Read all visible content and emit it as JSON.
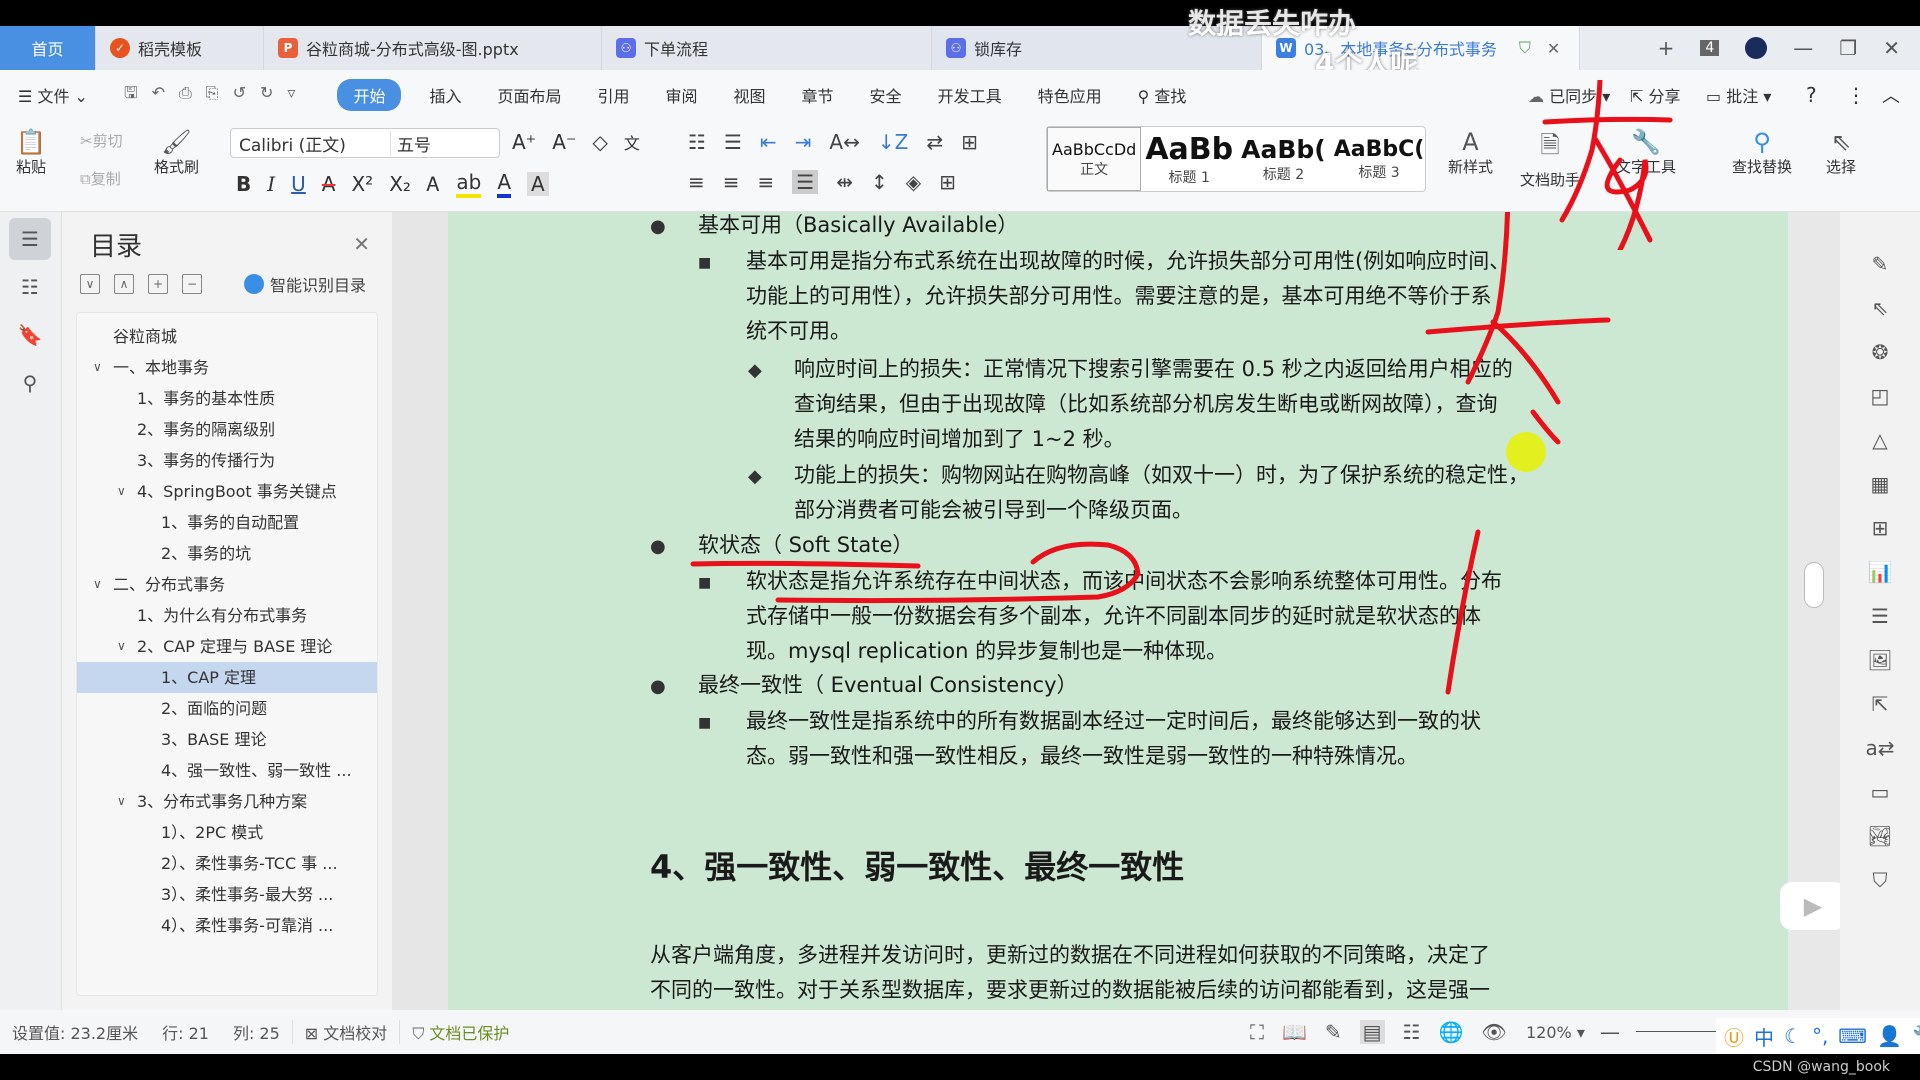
{
  "overlay_captions": [
    "数据丢失咋办",
    "4个人呢"
  ],
  "tabs": [
    {
      "label": "首页"
    },
    {
      "label": "稻壳模板",
      "icon": "docer-icon",
      "color": "#e8521f"
    },
    {
      "label": "谷粒商城-分布式高级-图.pptx",
      "icon": "pptx-icon",
      "color": "#e8613a"
    },
    {
      "label": "下单流程",
      "icon": "flowchart-icon",
      "color": "#5b6fe8"
    },
    {
      "label": "锁库存",
      "icon": "flowchart-icon",
      "color": "#5b6fe8"
    },
    {
      "label": "03、本地事务&分布式事务",
      "icon": "word-icon",
      "color": "#3d7fe0",
      "active": true
    }
  ],
  "window": {
    "tab_count": "4"
  },
  "menu": {
    "file": "文件",
    "items": [
      "开始",
      "插入",
      "页面布局",
      "引用",
      "审阅",
      "视图",
      "章节",
      "安全",
      "开发工具",
      "特色应用"
    ],
    "search": "查找",
    "synced": "已同步",
    "share": "分享",
    "comment": "批注"
  },
  "ribbon": {
    "paste": "粘贴",
    "cut": "剪切",
    "copy": "复制",
    "format_painter": "格式刷",
    "font_name": "Calibri (正文)",
    "font_size": "五号",
    "styles": [
      {
        "preview": "AaBbCcDd",
        "label": "正文"
      },
      {
        "preview": "AaBb",
        "label": "标题 1"
      },
      {
        "preview": "AaBb(",
        "label": "标题 2"
      },
      {
        "preview": "AaBbC(",
        "label": "标题 3"
      }
    ],
    "new_style": "新样式",
    "doc_assistant": "文档助手",
    "text_tools": "文字工具",
    "find_replace": "查找替换",
    "select": "选择"
  },
  "toc": {
    "title": "目录",
    "smart": "智能识别目录",
    "items": [
      {
        "label": "谷粒商城",
        "level": 0
      },
      {
        "label": "一、本地事务",
        "level": 0,
        "expanded": true
      },
      {
        "label": "1、事务的基本性质",
        "level": 1
      },
      {
        "label": "2、事务的隔离级别",
        "level": 1
      },
      {
        "label": "3、事务的传播行为",
        "level": 1
      },
      {
        "label": "4、SpringBoot 事务关键点",
        "level": 1,
        "expanded": true
      },
      {
        "label": "1、事务的自动配置",
        "level": 2
      },
      {
        "label": "2、事务的坑",
        "level": 2
      },
      {
        "label": "二、分布式事务",
        "level": 0,
        "expanded": true
      },
      {
        "label": "1、为什么有分布式事务",
        "level": 1
      },
      {
        "label": "2、CAP 定理与 BASE 理论",
        "level": 1,
        "expanded": true
      },
      {
        "label": "1、CAP 定理",
        "level": 2,
        "selected": true
      },
      {
        "label": "2、面临的问题",
        "level": 2
      },
      {
        "label": "3、BASE 理论",
        "level": 2
      },
      {
        "label": "4、强一致性、弱一致性 ...",
        "level": 2
      },
      {
        "label": "3、分布式事务几种方案",
        "level": 1,
        "expanded": true
      },
      {
        "label": "1）、2PC 模式",
        "level": 2
      },
      {
        "label": "2）、柔性事务-TCC 事 ...",
        "level": 2
      },
      {
        "label": "3）、柔性事务-最大努 ...",
        "level": 2
      },
      {
        "label": "4）、柔性事务-可靠消 ...",
        "level": 2
      }
    ]
  },
  "document": {
    "b1": "基本可用（Basically Available）",
    "b1_p": [
      "基本可用是指分布式系统在出现故障的时候，允许损失部分可用性(例如响应时间、",
      "功能上的可用性），允许损失部分可用性。需要注意的是，基本可用绝不等价于系",
      "统不可用。"
    ],
    "b1_d1": [
      "响应时间上的损失：正常情况下搜索引擎需要在 0.5 秒之内返回给用户相应的",
      "查询结果，但由于出现故障（比如系统部分机房发生断电或断网故障），查询",
      "结果的响应时间增加到了 1~2 秒。"
    ],
    "b1_d2": [
      "功能上的损失：购物网站在购物高峰（如双十一）时，为了保护系统的稳定性，",
      "部分消费者可能会被引导到一个降级页面。"
    ],
    "b2": "软状态（  Soft State）",
    "b2_p": [
      "软状态是指允许系统存在中间状态，而该中间状态不会影响系统整体可用性。分布",
      "式存储中一般一份数据会有多个副本，允许不同副本同步的延时就是软状态的体",
      "现。mysql replication 的异步复制也是一种体现。"
    ],
    "b3": "最终一致性（  Eventual Consistency）",
    "b3_p": [
      "最终一致性是指系统中的所有数据副本经过一定时间后，最终能够达到一致的状",
      "态。弱一致性和强一致性相反，最终一致性是弱一致性的一种特殊情况。"
    ],
    "heading4": "4、强一致性、弱一致性、最终一致性",
    "para": [
      "从客户端角度，多进程并发访问时，更新过的数据在不同进程如何获取的不同策略，决定了",
      "不同的一致性。对于关系型数据库，要求更新过的数据能被后续的访问都能看到，这是强一"
    ]
  },
  "status": {
    "setting": "设置值: 23.2厘米",
    "row": "行: 21",
    "col": "列: 25",
    "proof": "文档校对",
    "protected": "文档已保护",
    "zoom": "120%"
  },
  "ime": {
    "mode": "中"
  },
  "watermark": "CSDN @wang_book",
  "colors": {
    "accent": "#4a90e2",
    "page_bg": "#cde8d2",
    "annotation": "#e8101a"
  }
}
